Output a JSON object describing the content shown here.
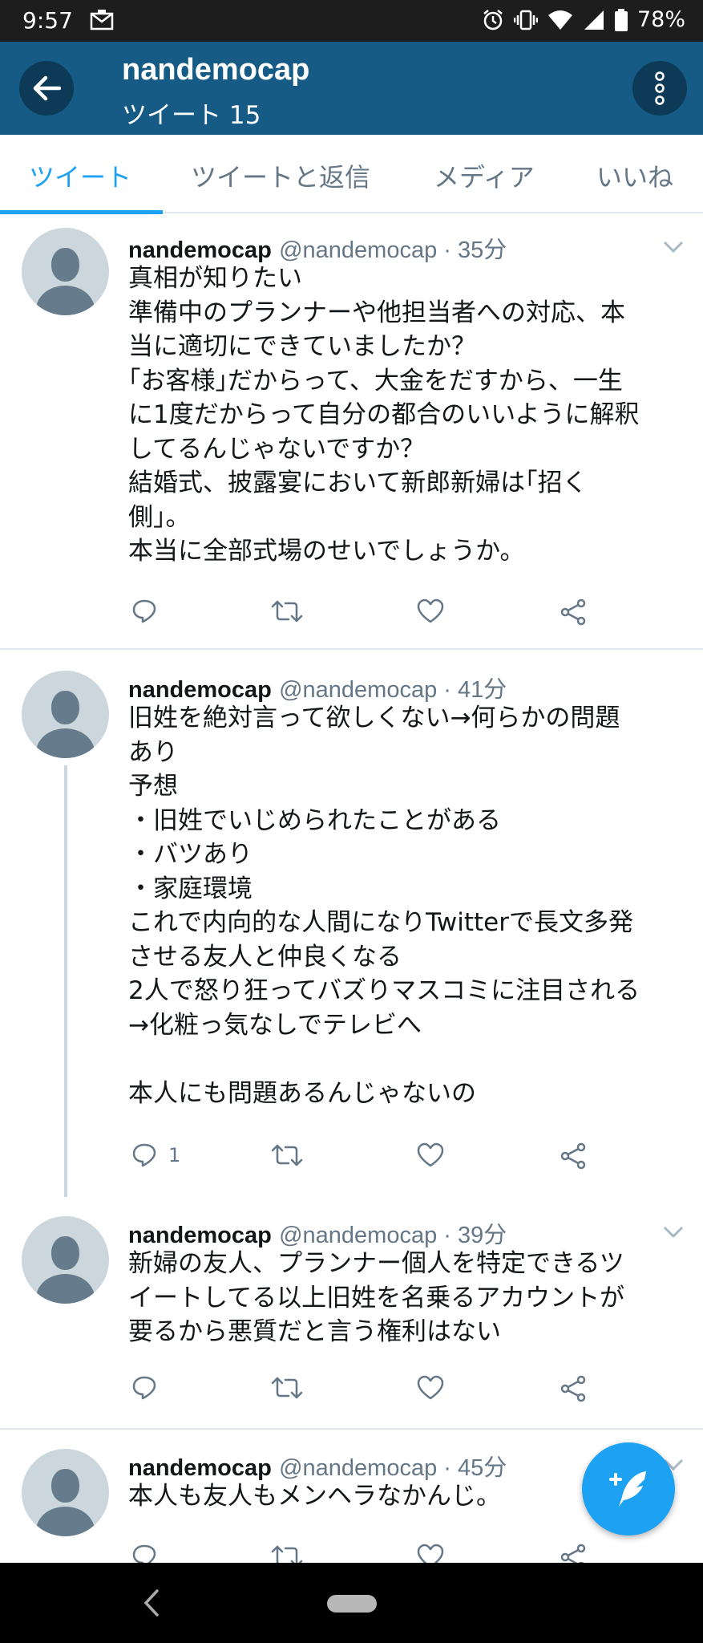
{
  "status_bar": {
    "time": "9:57",
    "battery": "78%",
    "icons": [
      "notification-icon",
      "alarm-icon",
      "vibrate-icon",
      "wifi-icon",
      "signal-icon",
      "battery-icon"
    ]
  },
  "header": {
    "title": "nandemocap",
    "subtitle": "ツイート 15",
    "colors": {
      "bar": "#155b85",
      "button": "#0c3a57"
    }
  },
  "tabs": [
    {
      "label": "ツイート",
      "active": true
    },
    {
      "label": "ツイートと返信",
      "active": false
    },
    {
      "label": "メディア",
      "active": false
    },
    {
      "label": "いいね",
      "active": false
    }
  ],
  "accent_color": "#1da1f2",
  "tweets": [
    {
      "name": "nandemocap",
      "handle": "@nandemocap · 35分",
      "lines": [
        "真相が知りたい",
        "準備中のプランナーや他担当者への対応、本",
        "当に適切にできていましたか？",
        "｢お客様｣だからって、大金をだすから、一生",
        "に1度だからって自分の都合のいいように解釈",
        "してるんじゃないですか？",
        "結婚式、披露宴において新郎新婦は｢招く",
        "側｣。",
        "本当に全部式場のせいでしょうか。"
      ],
      "reply_count": ""
    },
    {
      "name": "nandemocap",
      "handle": "@nandemocap · 41分",
      "lines": [
        "旧姓を絶対言って欲しくない→何らかの問題",
        "あり",
        "予想",
        "・旧姓でいじめられたことがある",
        "・バツあり",
        "・家庭環境",
        "これで内向的な人間になりTwitterで長文多発",
        "させる友人と仲良くなる",
        "2人で怒り狂ってバズりマスコミに注目される",
        "→化粧っ気なしでテレビへ",
        "",
        "本人にも問題あるんじゃないの"
      ],
      "reply_count": "1"
    },
    {
      "name": "nandemocap",
      "handle": "@nandemocap · 39分",
      "lines": [
        "新婦の友人、プランナー個人を特定できるツ",
        "イートしてる以上旧姓を名乗るアカウントが",
        "要るから悪質だと言う権利はない"
      ],
      "reply_count": ""
    },
    {
      "name": "nandemocap",
      "handle": "@nandemocap · 45分",
      "lines": [
        "本人も友人もメンヘラなかんじ。"
      ],
      "reply_count": ""
    }
  ],
  "actions": [
    "reply-icon",
    "retweet-icon",
    "like-icon",
    "share-icon"
  ]
}
